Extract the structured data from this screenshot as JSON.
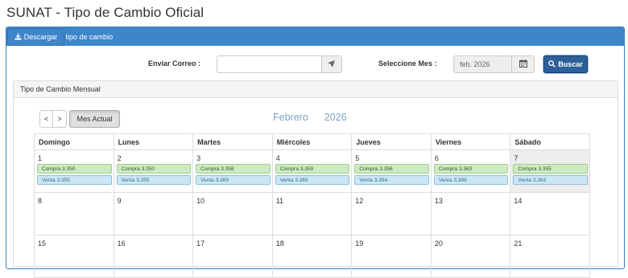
{
  "page": {
    "title": "SUNAT - Tipo de Cambio Oficial"
  },
  "panel": {
    "heading": "Consulta de tipo de cambio"
  },
  "toolbar": {
    "download_label": "Descargar",
    "email_label": "Enviar Correo :",
    "email_value": "",
    "month_label": "Seleccione Mes :",
    "month_value": "feb. 2026",
    "search_label": "Buscar"
  },
  "monthly": {
    "heading": "Tipo de Cambio Mensual"
  },
  "calendar": {
    "prev_label": "<",
    "next_label": ">",
    "today_label": "Mes Actual",
    "month_name": "Febrero",
    "year": "2026",
    "weekdays": [
      "Domingo",
      "Lunes",
      "Martes",
      "Miércoles",
      "Jueves",
      "Viernes",
      "Sábado"
    ],
    "weeks": [
      [
        {
          "day": "1",
          "buy": "3.350",
          "sell": "3.355"
        },
        {
          "day": "2",
          "buy": "3.350",
          "sell": "3.355"
        },
        {
          "day": "3",
          "buy": "3.358",
          "sell": "3.369"
        },
        {
          "day": "4",
          "buy": "3.359",
          "sell": "3.365"
        },
        {
          "day": "5",
          "buy": "3.356",
          "sell": "3.364"
        },
        {
          "day": "6",
          "buy": "3.363",
          "sell": "3.368"
        },
        {
          "day": "7",
          "buy": "3.355",
          "sell": "3.363"
        }
      ],
      [
        {
          "day": "8"
        },
        {
          "day": "9"
        },
        {
          "day": "10"
        },
        {
          "day": "11"
        },
        {
          "day": "12"
        },
        {
          "day": "13"
        },
        {
          "day": "14"
        }
      ],
      [
        {
          "day": "15"
        },
        {
          "day": "16"
        },
        {
          "day": "17"
        },
        {
          "day": "18"
        },
        {
          "day": "19"
        },
        {
          "day": "20"
        },
        {
          "day": "21"
        }
      ]
    ],
    "buy_label": "Compra",
    "sell_label": "Venta"
  },
  "colors": {
    "primary": "#3f86c9",
    "search_button": "#2d5f99",
    "buy_badge": "#cfeac3",
    "sell_badge": "#cbe6f5",
    "title_accent": "#7aa2c9"
  },
  "icons": {
    "panel_heading": "calendar-icon",
    "download": "download-icon",
    "email_send": "send-icon",
    "month_picker": "calendar-icon",
    "search": "search-icon"
  }
}
